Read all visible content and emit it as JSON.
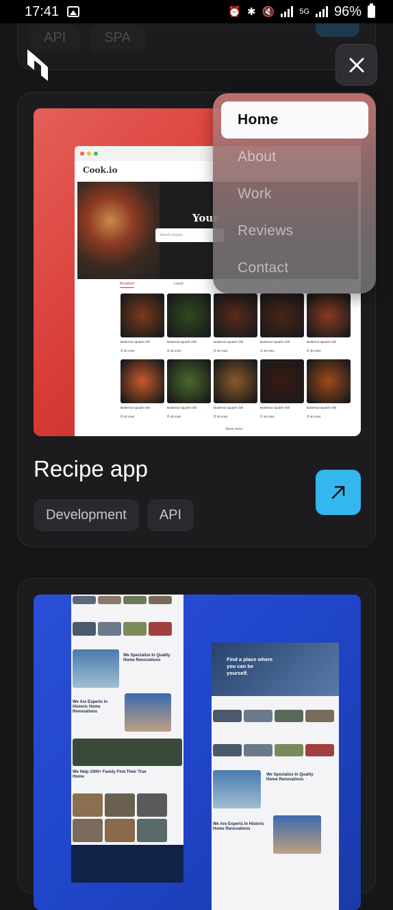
{
  "status_bar": {
    "time": "17:41",
    "battery": "96%",
    "net": "5G"
  },
  "prev_card": {
    "tags": [
      "API",
      "SPA"
    ]
  },
  "menu": {
    "items": [
      {
        "label": "Home",
        "active": true
      },
      {
        "label": "About",
        "active": false
      },
      {
        "label": "Work",
        "active": false
      },
      {
        "label": "Reviews",
        "active": false
      },
      {
        "label": "Contact",
        "active": false
      }
    ]
  },
  "projects": [
    {
      "title": "Recipe app",
      "tags": [
        "Development",
        "API"
      ],
      "preview": {
        "logo": "Cook.io",
        "hero_text": "Your",
        "search_placeholder": "Search recipes...",
        "tabs": [
          "Breakfast",
          "Lunch"
        ],
        "card_caption": "Butternut squash chili",
        "card_time": "40 mins",
        "show_more": "Show more"
      }
    },
    {
      "title": "",
      "tags": [],
      "preview": {
        "hero_text": "Find a place where you can be yourself.",
        "section1": "We Specialize In Quality Home Renovations",
        "section2": "We Are Experts In Historic Home Renovations",
        "section3": "We Help 1000+ Family Find Their True Home"
      }
    }
  ],
  "colors": {
    "accent": "#34b7ef",
    "bg": "#161618",
    "card": "#1c1c1f"
  }
}
